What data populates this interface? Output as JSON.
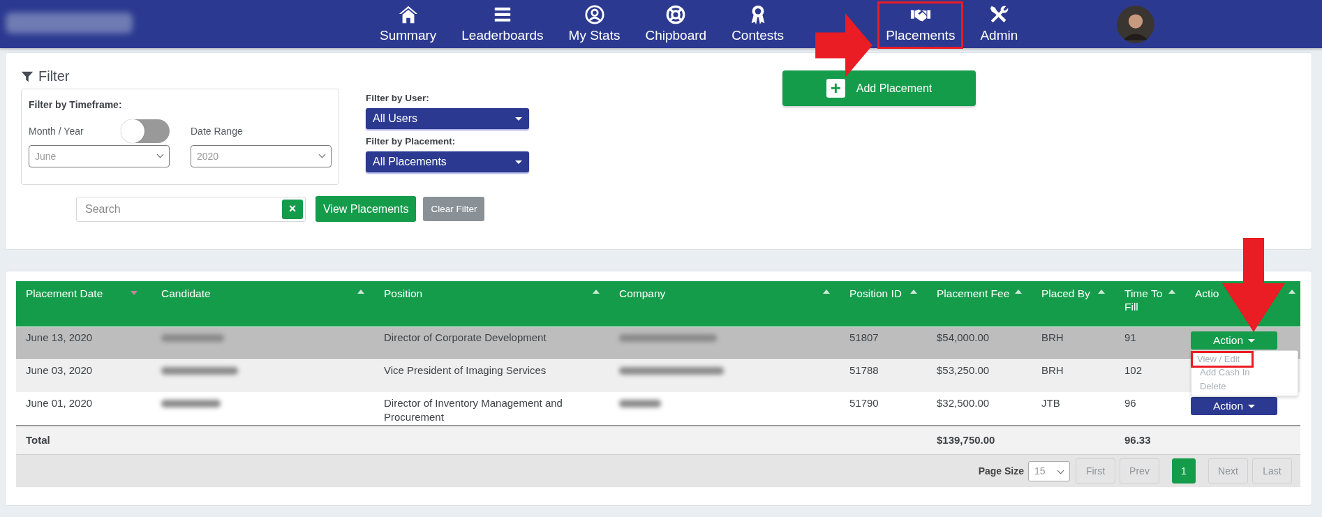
{
  "header": {
    "logo_blurred": true,
    "avatar": true,
    "nav": [
      {
        "label": "Summary",
        "kind": "house",
        "annotated": false
      },
      {
        "label": "Leaderboards",
        "kind": "bars",
        "annotated": false
      },
      {
        "label": "My Stats",
        "kind": "person",
        "annotated": false
      },
      {
        "label": "Chipboard",
        "kind": "lifebuoy",
        "annotated": false
      },
      {
        "label": "Contests",
        "kind": "award",
        "annotated": false
      },
      {
        "label": "Placements",
        "kind": "handshake",
        "annotated": true
      },
      {
        "label": "Admin",
        "kind": "tools",
        "annotated": false
      }
    ]
  },
  "filter": {
    "title": "Filter",
    "timeframe": {
      "title": "Filter by Timeframe:",
      "left_label": "Month / Year",
      "right_label": "Date Range",
      "toggle_on": false,
      "month": "June",
      "year": "2020"
    },
    "user": {
      "label": "Filter by User:",
      "value": "All Users"
    },
    "placement": {
      "label": "Filter by Placement:",
      "value": "All Placements"
    },
    "search": {
      "placeholder": "Search",
      "clear": "×"
    },
    "view_button": "View Placements",
    "clear_button": "Clear Filter"
  },
  "add_button": {
    "label": "Add Placement",
    "icon": "+"
  },
  "table": {
    "columns": [
      {
        "label": "Placement Date",
        "sorted": true
      },
      {
        "label": "Candidate",
        "sorted": false
      },
      {
        "label": "Position",
        "sorted": false
      },
      {
        "label": "Company",
        "sorted": false
      },
      {
        "label": "Position ID",
        "sorted": false
      },
      {
        "label": "Placement Fee",
        "sorted": false
      },
      {
        "label": "Placed By",
        "sorted": false
      },
      {
        "label": "Time To Fill",
        "sorted": false
      },
      {
        "label": "Actio",
        "sorted": false
      }
    ],
    "rows": [
      {
        "selected": true,
        "date": "June 13, 2020",
        "candidate_blurred": true,
        "position": "Director of Corporate Development",
        "company_blurred": true,
        "position_id": "51807",
        "fee": "$54,000.00",
        "placed_by": "BRH",
        "time_to_fill": "91",
        "action": {
          "label": "Action",
          "open": true,
          "pointed": true,
          "menu": [
            {
              "label": "View / Edit",
              "highlighted": true
            },
            {
              "label": "Add Cash In",
              "highlighted": false
            },
            {
              "label": "Delete",
              "highlighted": false
            }
          ]
        }
      },
      {
        "selected": false,
        "date": "June 03, 2020",
        "candidate_blurred": true,
        "position": "Vice President of Imaging Services",
        "company_blurred": true,
        "position_id": "51788",
        "fee": "$53,250.00",
        "placed_by": "BRH",
        "time_to_fill": "102"
      },
      {
        "selected": false,
        "date": "June 01, 2020",
        "candidate_blurred": true,
        "position": "Director of Inventory Management and Procurement",
        "company_blurred": true,
        "position_id": "51790",
        "fee": "$32,500.00",
        "placed_by": "JTB",
        "time_to_fill": "96",
        "action": {
          "label": "Action",
          "open": false,
          "pointed": false
        }
      }
    ],
    "total": {
      "label": "Total",
      "fee": "$139,750.00",
      "time_to_fill": "96.33"
    },
    "pagination": {
      "page_size_label": "Page Size",
      "page_size": "15",
      "buttons": [
        {
          "label": "First",
          "selected": false,
          "disabled": true
        },
        {
          "label": "Prev",
          "selected": false,
          "disabled": true
        },
        {
          "label": "1",
          "selected": true,
          "disabled": false
        },
        {
          "label": "Next",
          "selected": false,
          "disabled": true
        },
        {
          "label": "Last",
          "selected": false,
          "disabled": true
        }
      ]
    }
  }
}
